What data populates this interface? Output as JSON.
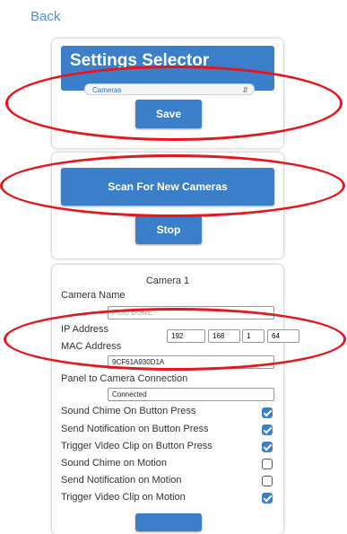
{
  "nav": {
    "back_label": "Back"
  },
  "settings_selector": {
    "title": "Settings Selector",
    "selected_option": "Cameras",
    "save_label": "Save"
  },
  "scan": {
    "scan_label": "Scan For New Cameras",
    "stop_label": "Stop"
  },
  "camera": {
    "title": "Camera 1",
    "name_label": "Camera Name",
    "name_value": "FIOC DOME",
    "ip_label": "IP Address",
    "ip_octets": [
      "192",
      "168",
      "1",
      "64"
    ],
    "mac_label": "MAC Address",
    "mac_value": "9CF61A930D1A",
    "connection_label": "Panel to Camera Connection",
    "connection_value": "Connected",
    "options": [
      {
        "label": "Sound Chime On Button Press",
        "checked": true
      },
      {
        "label": "Send Notification on Button Press",
        "checked": true
      },
      {
        "label": "Trigger Video Clip on Button Press",
        "checked": true
      },
      {
        "label": "Sound Chime on Motion",
        "checked": false
      },
      {
        "label": "Send Notification on Motion",
        "checked": false
      },
      {
        "label": "Trigger Video Clip on Motion",
        "checked": true
      }
    ]
  },
  "colors": {
    "accent": "#3b7fcb",
    "link": "#4a90e2",
    "annotation": "#e8151b"
  }
}
